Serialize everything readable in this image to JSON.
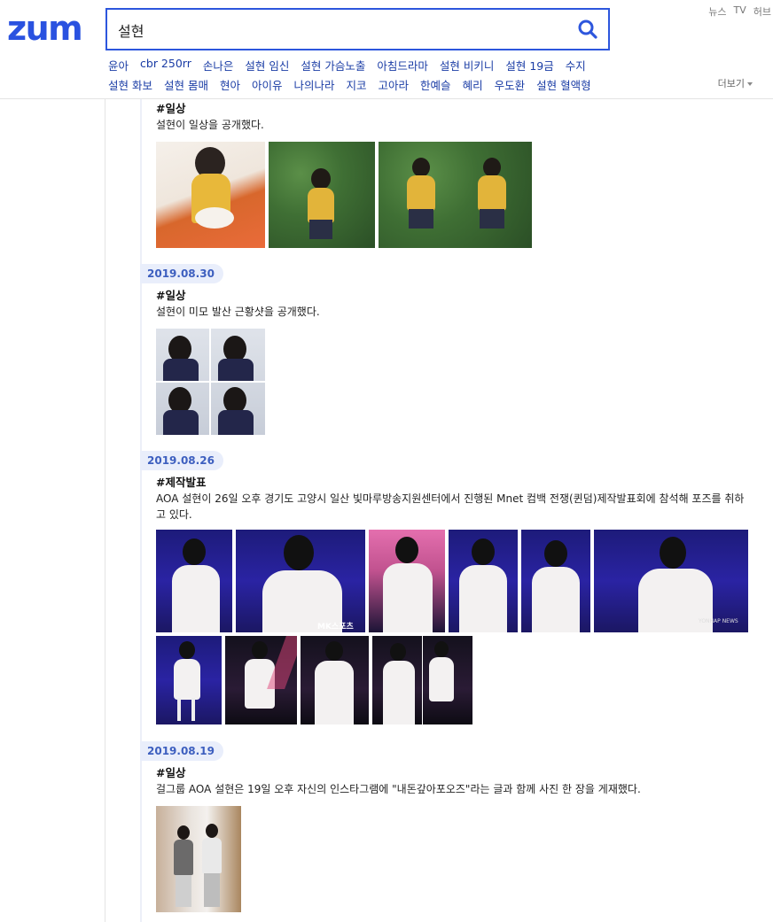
{
  "header": {
    "logo": "zum",
    "search_value": "설현",
    "top_links": [
      "뉴스",
      "TV",
      "허브"
    ],
    "related_row1": [
      "윤아",
      "cbr 250rr",
      "손나은",
      "설현 임신",
      "설현 가슴노출",
      "아침드라마",
      "설현 비키니",
      "설현 19금",
      "수지"
    ],
    "related_row2": [
      "설현 화보",
      "설현 몸매",
      "현아",
      "아이유",
      "나의나라",
      "지코",
      "고아라",
      "한예슬",
      "혜리",
      "우도환",
      "설현 혈액형"
    ],
    "more_label": "더보기"
  },
  "timeline": [
    {
      "date": "",
      "tag": "#일상",
      "desc": "설현이 일상을 공개했다."
    },
    {
      "date": "2019.08.30",
      "tag": "#일상",
      "desc": "설현이 미모 발산 근황샷을 공개했다."
    },
    {
      "date": "2019.08.26",
      "tag": "#제작발표",
      "desc": "AOA 설현이 26일 오후 경기도 고양시 일산 빛마루방송지원센터에서 진행된 Mnet 컴백 전쟁(퀸덤)제작발표회에 참석해 포즈를 취하고 있다."
    },
    {
      "date": "2019.08.19",
      "tag": "#일상",
      "desc": "걸그룹 AOA 설현은 19일 오후 자신의 인스타그램에 \"내돈갚아포오즈\"라는 글과 함께 사진 한 장을 게재했다."
    }
  ],
  "watermarks": [
    "MK스포츠",
    "YONHAP NEWS"
  ],
  "colors": {
    "brand": "#2a52e0",
    "link": "#1a3ca5",
    "date_badge_bg": "#e9eefb",
    "date_badge_text": "#3d5fbf"
  }
}
